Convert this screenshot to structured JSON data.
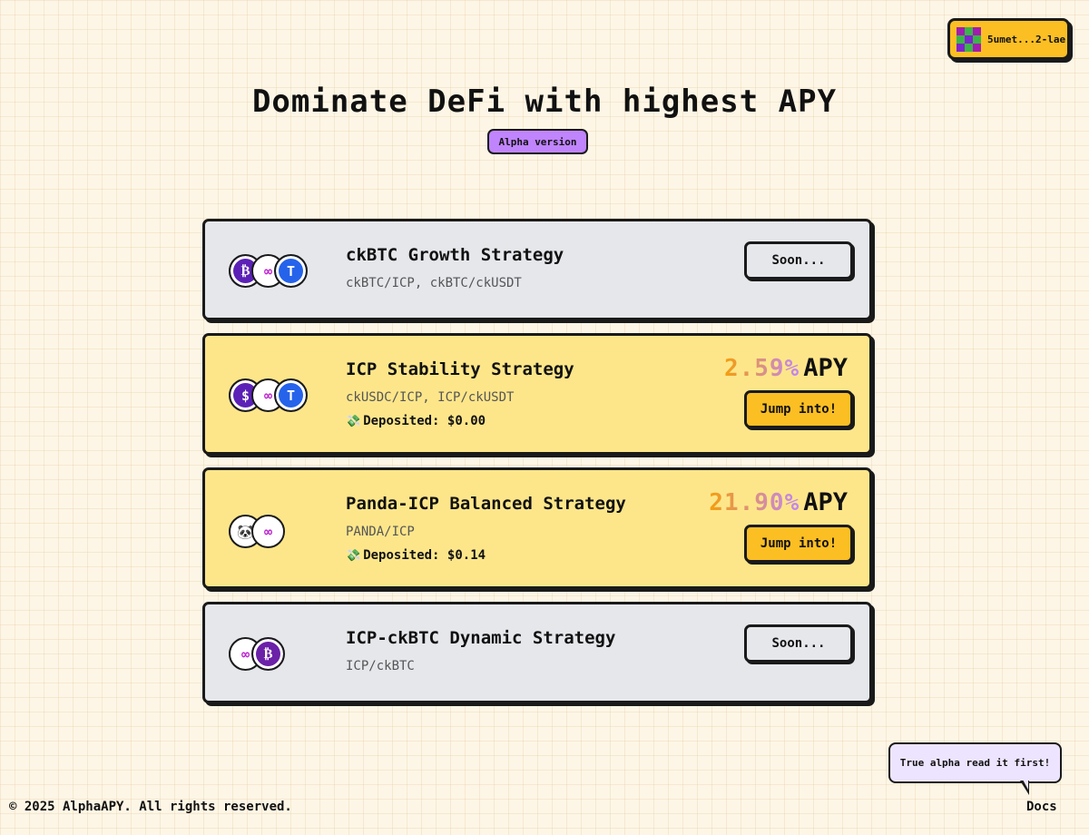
{
  "wallet": {
    "address": "5umet...2-lae",
    "avatar_icon": "pixel-avatar-icon"
  },
  "header": {
    "title": "Dominate DeFi with highest APY",
    "badge": "Alpha version"
  },
  "strategies": [
    {
      "name": "ckBTC Growth Strategy",
      "pairs": "ckBTC/ICP, ckBTC/ckUSDT",
      "button": "Soon...",
      "icons": [
        "ckbtc-icon",
        "icp-icon",
        "ckusdt-icon"
      ]
    },
    {
      "name": "ICP Stability Strategy",
      "pairs": "ckUSDC/ICP, ICP/ckUSDT",
      "deposited": "Deposited: $0.00",
      "apy": "2.59%",
      "apy_label": "APY",
      "button": "Jump into!",
      "icons": [
        "ckusdc-icon",
        "icp-icon",
        "ckusdt-icon"
      ]
    },
    {
      "name": "Panda-ICP Balanced Strategy",
      "pairs": "PANDA/ICP",
      "deposited": "Deposited: $0.14",
      "apy": "21.90%",
      "apy_label": "APY",
      "button": "Jump into!",
      "icons": [
        "panda-icon",
        "icp-icon"
      ]
    },
    {
      "name": "ICP-ckBTC Dynamic Strategy",
      "pairs": "ICP/ckBTC",
      "button": "Soon...",
      "icons": [
        "icp-icon",
        "ckbtc-icon"
      ]
    }
  ],
  "footer": {
    "bubble": "True alpha read it first!",
    "copyright": "© 2025 AlphaAPY. All rights reserved.",
    "docs": "Docs"
  },
  "colors": {
    "accent": "#fbbf24",
    "badge": "#c084fc",
    "card_active": "#fde68a",
    "card_inactive": "#e5e7eb",
    "background": "#fdf6e6"
  }
}
